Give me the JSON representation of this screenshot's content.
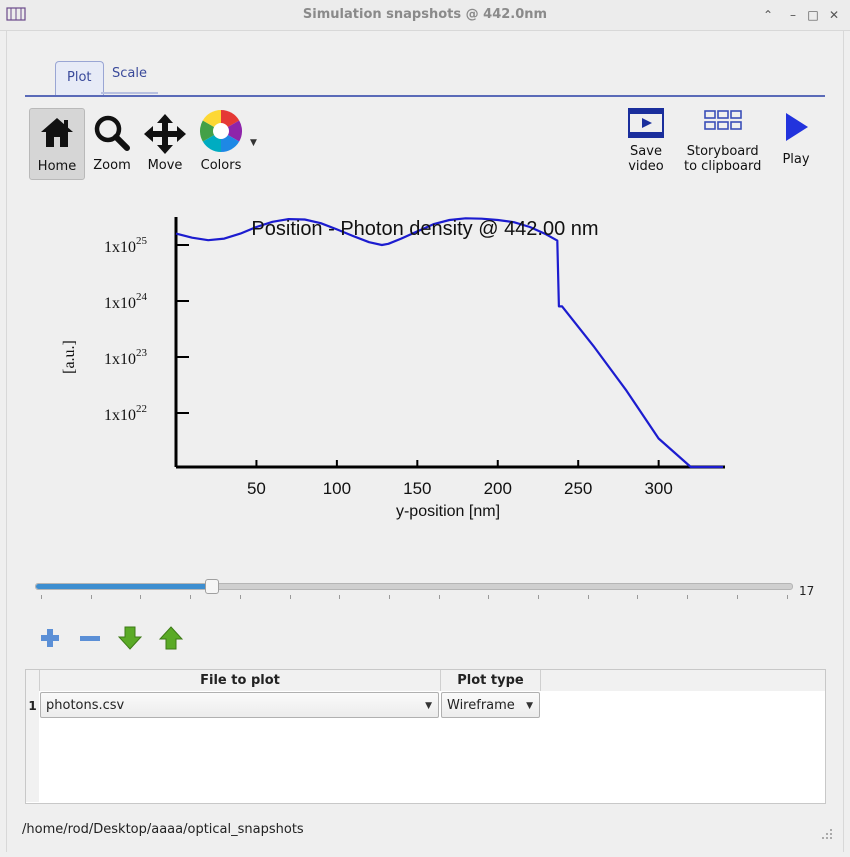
{
  "window": {
    "title": "Simulation snapshots @ 442.0nm"
  },
  "tabs": [
    {
      "label": "Plot"
    },
    {
      "label": "Scale"
    }
  ],
  "toolbar": {
    "home_label": "Home",
    "zoom_label": "Zoom",
    "move_label": "Move",
    "colors_label": "Colors",
    "save_video_label_1": "Save",
    "save_video_label_2": "video",
    "storyboard_label_1": "Storyboard",
    "storyboard_label_2": "to clipboard",
    "play_label": "Play"
  },
  "chart_data": {
    "type": "line",
    "title": "Position - Photon density @ 442.00 nm",
    "xlabel": "y-position [nm]",
    "ylabel": "[a.u.]",
    "xlim": [
      0,
      340
    ],
    "ylim": [
      1e+21,
      1e+26
    ],
    "yscale": "log",
    "x_ticks": [
      "50",
      "100",
      "150",
      "200",
      "250",
      "300"
    ],
    "y_ticks": [
      {
        "base": "1x10",
        "exp": "25"
      },
      {
        "base": "1x10",
        "exp": "24"
      },
      {
        "base": "1x10",
        "exp": "23"
      },
      {
        "base": "1x10",
        "exp": "22"
      }
    ],
    "series": [
      {
        "color": "#1c1ccf",
        "x": [
          0,
          10,
          20,
          30,
          40,
          50,
          60,
          70,
          80,
          90,
          100,
          110,
          120,
          128,
          132,
          140,
          150,
          160,
          170,
          180,
          190,
          200,
          210,
          220,
          230,
          237,
          238,
          240,
          260,
          280,
          300,
          320,
          340
        ],
        "y": [
          1.6e+25,
          1.35e+25,
          1.22e+25,
          1.3e+25,
          1.6e+25,
          2.1e+25,
          2.6e+25,
          2.9e+25,
          2.85e+25,
          2.45e+25,
          1.9e+25,
          1.45e+25,
          1.12e+25,
          1e+25,
          1.05e+25,
          1.3e+25,
          1.75e+25,
          2.35e+25,
          2.8e+25,
          3e+25,
          2.95e+25,
          2.8e+25,
          2.55e+25,
          2.1e+25,
          1.55e+25,
          1.2e+25,
          8e+23,
          8e+23,
          1.5e+23,
          2.5e+22,
          3.5e+21,
          4.5e+20,
          2.5e+19
        ]
      }
    ]
  },
  "slider": {
    "value": "17",
    "fraction": 0.232
  },
  "actions": {
    "add": "plus-icon",
    "remove": "minus-icon",
    "down": "arrow-down-icon",
    "up": "arrow-up-icon"
  },
  "table": {
    "headers": [
      "File to plot",
      "Plot type"
    ],
    "rows": [
      {
        "num": "1",
        "file": "photons.csv",
        "type": "Wireframe"
      }
    ]
  },
  "status": {
    "path": "/home/rod/Desktop/aaaa/optical_snapshots"
  }
}
